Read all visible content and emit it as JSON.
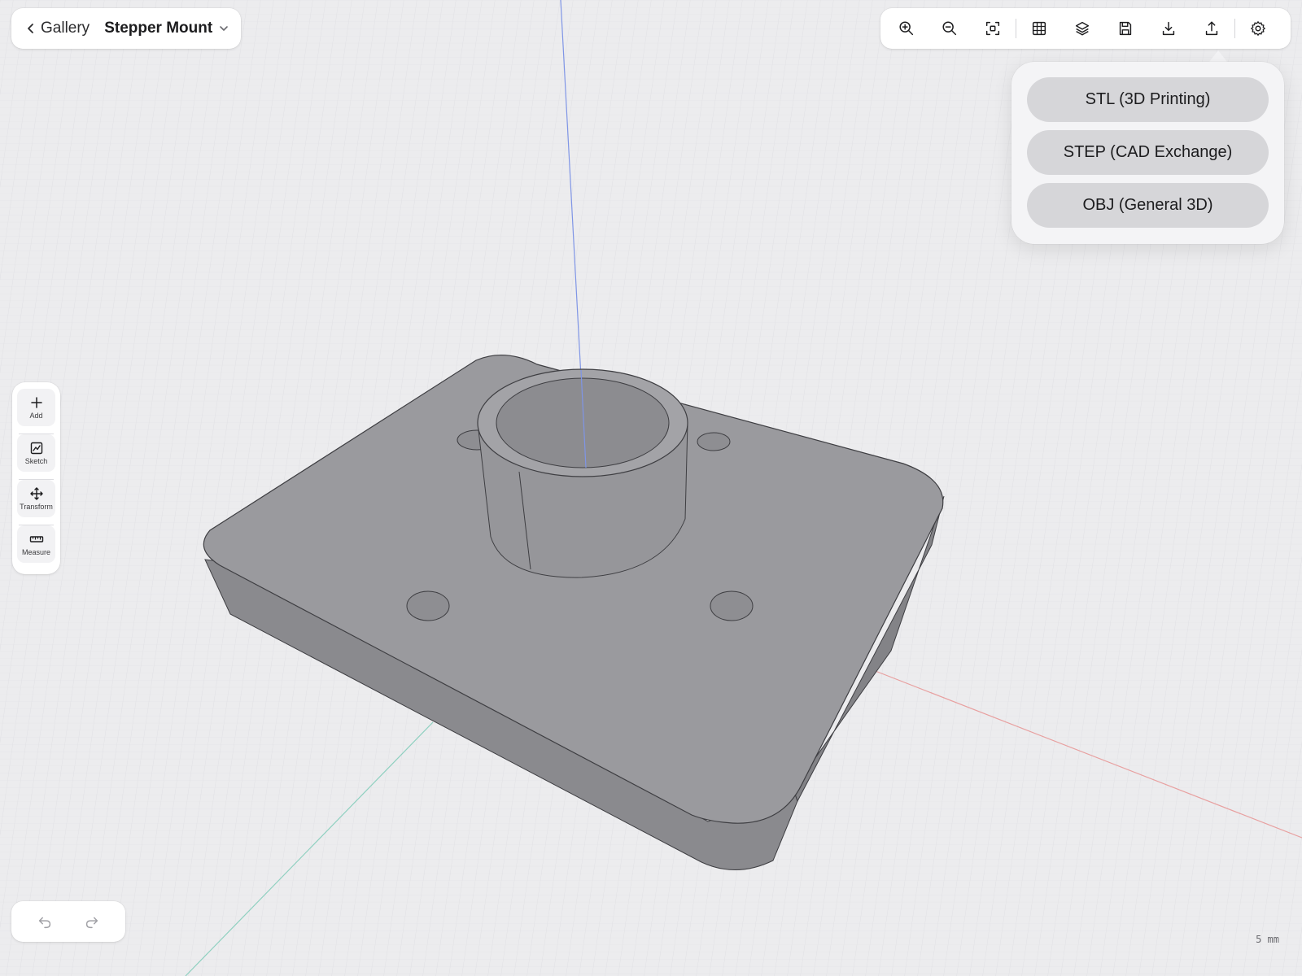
{
  "header": {
    "back_label": "Gallery",
    "document_title": "Stepper Mount"
  },
  "toolbar": {
    "buttons": [
      "zoom-in-icon",
      "zoom-out-icon",
      "fit-view-icon",
      "grid-icon",
      "layers-icon",
      "save-icon",
      "download-icon",
      "export-icon",
      "settings-icon"
    ]
  },
  "export_menu": {
    "options": [
      {
        "label": "STL (3D Printing)"
      },
      {
        "label": "STEP (CAD Exchange)"
      },
      {
        "label": "OBJ (General 3D)"
      }
    ]
  },
  "tools": [
    {
      "label": "Add",
      "icon": "plus-icon"
    },
    {
      "label": "Sketch",
      "icon": "sketch-icon"
    },
    {
      "label": "Transform",
      "icon": "move-arrows-icon"
    },
    {
      "label": "Measure",
      "icon": "ruler-icon"
    }
  ],
  "history": {
    "undo_icon": "undo-icon",
    "redo_icon": "redo-icon"
  },
  "viewport": {
    "scale_label": "5 mm",
    "model_name": "Stepper Mount",
    "axis_colors": {
      "x": "#e8a0a0",
      "y": "#8fd0c0",
      "z": "#7f95e6"
    },
    "model_color": "#9a9a9e"
  }
}
